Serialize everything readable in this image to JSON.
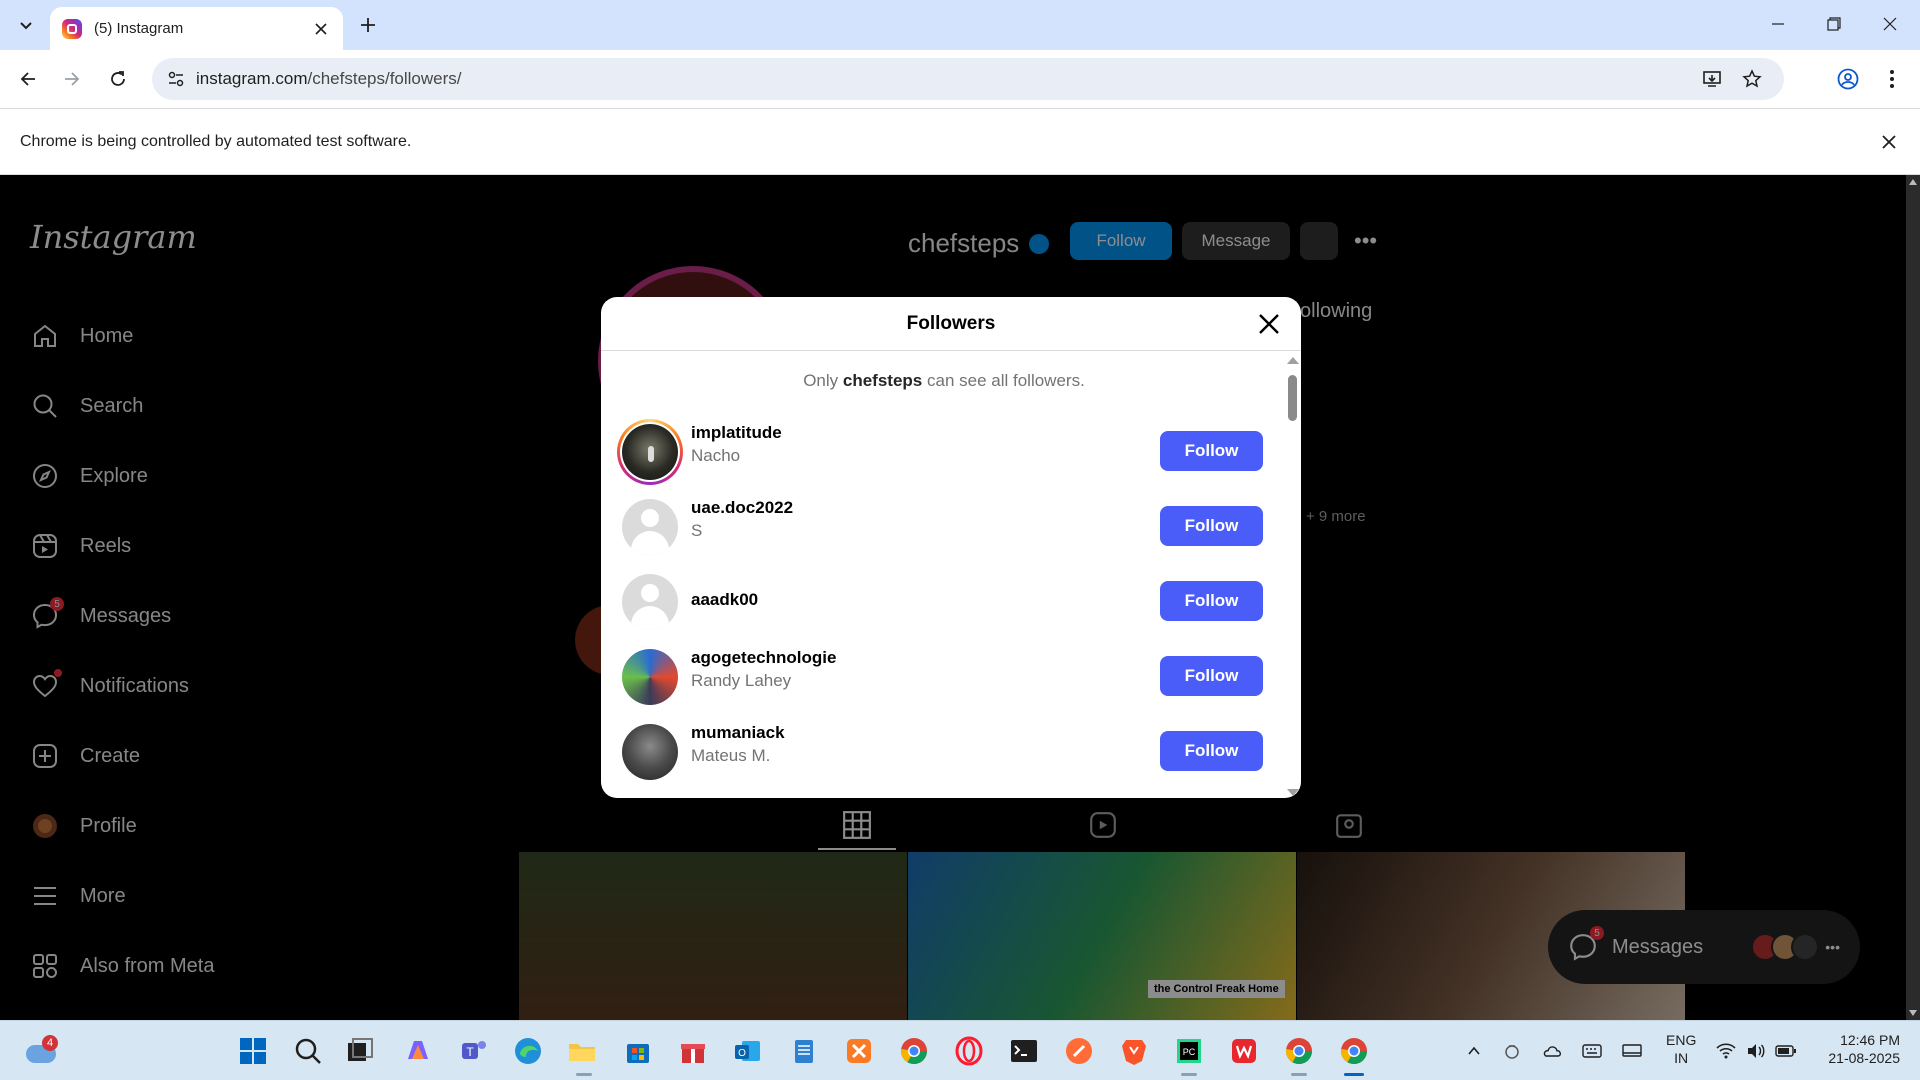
{
  "browser": {
    "tab_title": "(5) Instagram",
    "url_host": "instagram.com",
    "url_path": "/chefsteps/followers/",
    "infobar_message": "Chrome is being controlled by automated test software."
  },
  "sidebar": {
    "logo": "Instagram",
    "items": [
      {
        "label": "Home",
        "icon": "home-icon"
      },
      {
        "label": "Search",
        "icon": "search-icon"
      },
      {
        "label": "Explore",
        "icon": "compass-icon"
      },
      {
        "label": "Reels",
        "icon": "reels-icon"
      },
      {
        "label": "Messages",
        "icon": "messenger-icon",
        "badge": "5"
      },
      {
        "label": "Notifications",
        "icon": "heart-icon"
      },
      {
        "label": "Create",
        "icon": "plus-square-icon"
      },
      {
        "label": "Profile",
        "icon": "avatar-icon"
      },
      {
        "label": "More",
        "icon": "menu-icon"
      },
      {
        "label": "Also from Meta",
        "icon": "meta-apps-icon"
      }
    ]
  },
  "profile": {
    "username": "chefsteps",
    "follow_label": "Follow",
    "message_label": "Message",
    "following_fragment": "ollowing",
    "plus_more": "+ 9 more",
    "thumb_caption": "the Control Freak Home"
  },
  "modal": {
    "title": "Followers",
    "note_prefix": "Only ",
    "note_user": "chefsteps",
    "note_suffix": " can see all followers.",
    "followers": [
      {
        "username": "implatitude",
        "fullname": "Nacho",
        "button": "Follow"
      },
      {
        "username": "uae.doc2022",
        "fullname": "S",
        "button": "Follow"
      },
      {
        "username": "aaadk00",
        "fullname": "",
        "button": "Follow"
      },
      {
        "username": "agogetechnologie",
        "fullname": "Randy Lahey",
        "button": "Follow"
      },
      {
        "username": "mumaniack",
        "fullname": "Mateus M.",
        "button": "Follow"
      }
    ]
  },
  "messages_pill": {
    "label": "Messages",
    "badge": "5"
  },
  "taskbar": {
    "weather_badge": "4",
    "lang_line1": "ENG",
    "lang_line2": "IN",
    "time": "12:46 PM",
    "date": "21-08-2025"
  },
  "colors": {
    "follow_button": "#4a5df9",
    "instagram_blue": "#0095f6",
    "tabstrip": "#d3e3fd"
  }
}
